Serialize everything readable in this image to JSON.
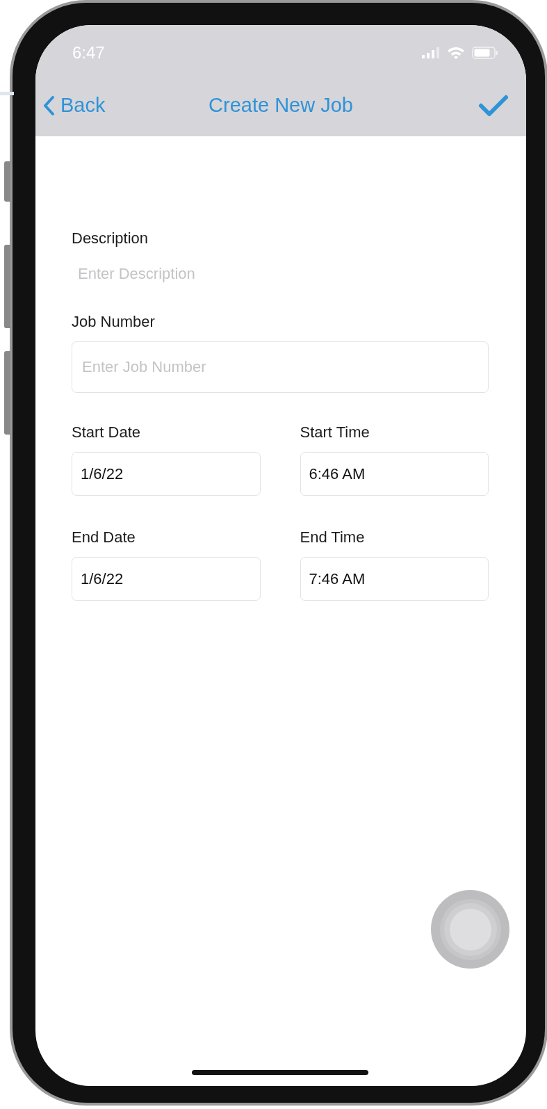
{
  "status_bar": {
    "time": "6:47"
  },
  "nav_bar": {
    "back": "Back",
    "title": "Create New Job"
  },
  "fields": [
    {
      "kind": "plain",
      "label": "Description",
      "placeholder": "Enter Description"
    },
    {
      "kind": "boxed",
      "label": "Job Number",
      "placeholder": "Enter Job Number"
    },
    {
      "kind": "half",
      "label": "Start Date",
      "value": "1/6/22"
    },
    {
      "kind": "half",
      "label": "Start Time",
      "value": "6:46 AM"
    },
    {
      "kind": "half",
      "label": "End Date",
      "value": "1/6/22"
    },
    {
      "kind": "half",
      "label": "End Time",
      "value": "7:46 AM"
    }
  ]
}
